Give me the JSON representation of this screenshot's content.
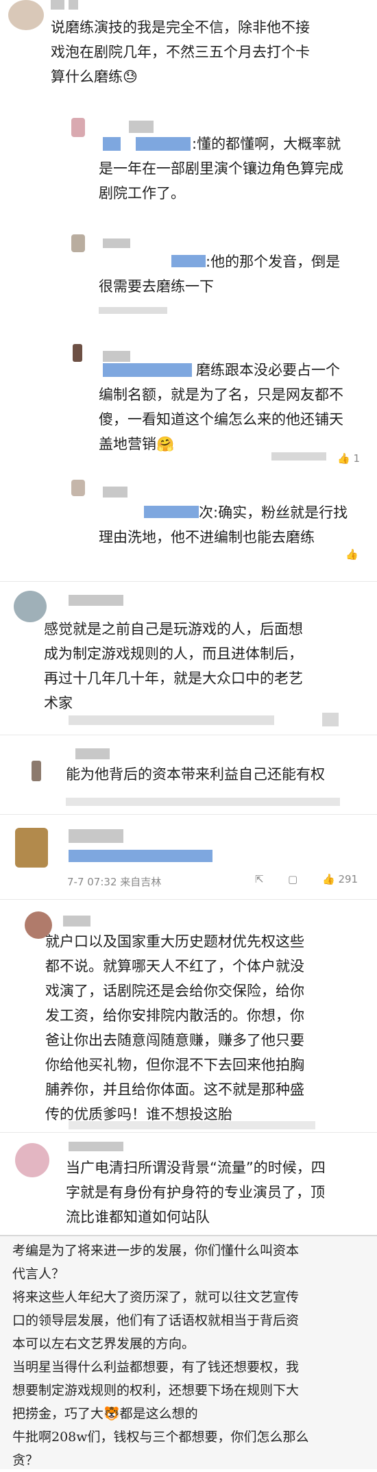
{
  "comments": [
    {
      "id": "c1",
      "text_lines": [
        "说磨练演技的我是完全不信，除非他不接",
        "戏泡在剧院几年，不然三五个月去打个卡",
        "算什么磨练😓"
      ],
      "replies": [
        {
          "text_lines": [
            ":懂的都懂啊，大概率就",
            "是一年在一部剧里演个镶边角色算完成",
            "剧院工作了。"
          ]
        },
        {
          "text_lines": [
            ":他的那个发音，倒是",
            "很需要去磨练一下"
          ]
        },
        {
          "text_lines": [
            "磨练跟本没必要占一个",
            "编制名额，就是为了名，只是网友都不",
            "傻，一看知道这个编怎么来的他还铺天",
            "盖地营销🤗"
          ],
          "like_count": "1"
        },
        {
          "text_lines": [
            "次:确实，粉丝就是行找",
            "理由洗地，他不进编制也能去磨练"
          ]
        }
      ]
    },
    {
      "id": "c2",
      "text_lines": [
        "感觉就是之前自己是玩游戏的人，后面想",
        "成为制定游戏规则的人，而且进体制后，",
        "再过十几年几十年，就是大众口中的老艺",
        "术家"
      ]
    },
    {
      "id": "c3",
      "text_lines": [
        "能为他背后的资本带来利益自己还能有权"
      ]
    },
    {
      "id": "c4",
      "timestamp": "7-7 07:32 来自吉林",
      "like_count": "291"
    },
    {
      "id": "c5",
      "text_lines": [
        "就户口以及国家重大历史题材优先权这些",
        "都不说。就算哪天人不红了，个体户就没",
        "戏演了，话剧院还是会给你交保险，给你",
        "发工资，给你安排院内散活的。你想，你",
        "爸让你出去随意闯随意赚，赚多了他只要",
        "你给他买礼物，但你混不下去回来他拍胸",
        "脯养你，并且给你体面。这不就是那种盛",
        "传的优质爹吗！谁不想投这胎"
      ]
    },
    {
      "id": "c6",
      "text_lines": [
        "当广电清扫所谓没背景“流量”的时候，四",
        "字就是有身份有护身符的专业演员了，顶",
        "流比谁都知道如何站队"
      ]
    }
  ],
  "screenshot_text": {
    "lines": [
      "考编是为了将来进一步的发展，你们懂什么叫资本",
      "代言人？",
      "将来这些人年纪大了资历深了，就可以往文艺宣传",
      "口的领导层发展，他们有了话语权就相当于背后资",
      "本可以左右文艺界发展的方向。",
      "当明星当得什么利益都想要，有了钱还想要权，我",
      "想要制定游戏规则的权利，还想要下场在规则下大",
      "把捞金，巧了大🐯都是这么想的",
      "牛批啊208w们，钱权与三个都想要，你们怎么那么",
      "贪？"
    ]
  },
  "icons": [
    "like-icon",
    "share-icon",
    "comment-icon"
  ],
  "colors": {
    "blur_gray": "#c8c8c8",
    "blur_blue": "#7ea7df",
    "text": "#1e1e1e",
    "meta": "#888888"
  }
}
